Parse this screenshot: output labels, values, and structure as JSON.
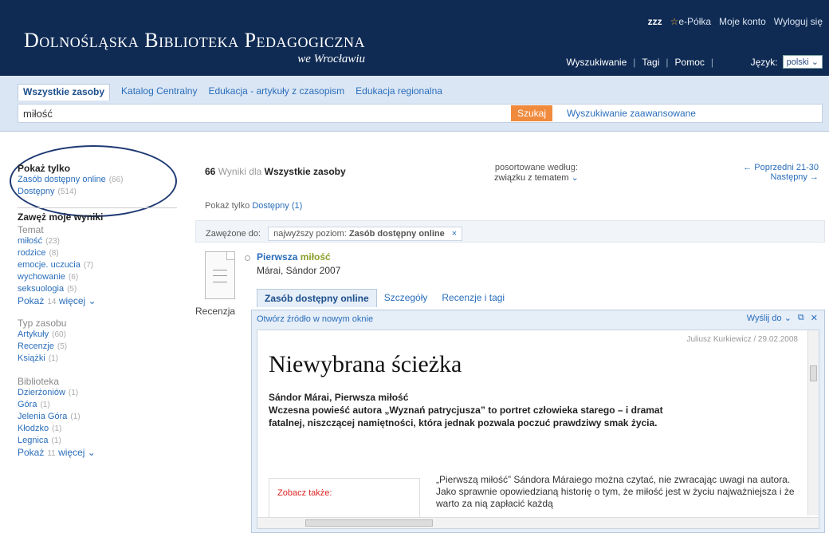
{
  "header": {
    "user": "zzz",
    "user_links": [
      "e-Półka",
      "Moje konto",
      "Wyloguj się"
    ],
    "logo_main": "Dolnośląska Biblioteka Pedagogiczna",
    "logo_sub": "we Wrocławiu",
    "nav": [
      "Wyszukiwanie",
      "Tagi",
      "Pomoc"
    ],
    "lang_label": "Język:",
    "lang_value": "polski"
  },
  "search": {
    "tabs": [
      "Wszystkie zasoby",
      "Katalog Centralny",
      "Edukacja - artykuły z czasopism",
      "Edukacja regionalna"
    ],
    "query": "miłość",
    "button": "Szukaj",
    "advanced": "Wyszukiwanie zaawansowane"
  },
  "sidebar": {
    "pokaz_title": "Pokaż tylko",
    "pokaz_items": [
      {
        "label": "Zasób dostępny online",
        "count": "(66)"
      },
      {
        "label": "Dostępny",
        "count": "(514)"
      }
    ],
    "zawez_title": "Zawęż moje wyniki",
    "temat_title": "Temat",
    "temat_items": [
      {
        "label": "miłość",
        "count": "(23)"
      },
      {
        "label": "rodzice",
        "count": "(8)"
      },
      {
        "label": "emocje. uczucia",
        "count": "(7)"
      },
      {
        "label": "wychowanie",
        "count": "(6)"
      },
      {
        "label": "seksuologia",
        "count": "(5)"
      }
    ],
    "temat_more": {
      "pre": "Pokaż",
      "count": "14",
      "post": "więcej"
    },
    "typ_title": "Typ zasobu",
    "typ_items": [
      {
        "label": "Artykuły",
        "count": "(60)"
      },
      {
        "label": "Recenzje",
        "count": "(5)"
      },
      {
        "label": "Książki",
        "count": "(1)"
      }
    ],
    "bib_title": "Biblioteka",
    "bib_items": [
      {
        "label": "Dzierżoniów",
        "count": "(1)"
      },
      {
        "label": "Góra",
        "count": "(1)"
      },
      {
        "label": "Jelenia Góra",
        "count": "(1)"
      },
      {
        "label": "Kłodzko",
        "count": "(1)"
      },
      {
        "label": "Legnica",
        "count": "(1)"
      }
    ],
    "bib_more": {
      "pre": "Pokaż",
      "count": "11",
      "post": "więcej"
    }
  },
  "results": {
    "count": "66",
    "for_label": "Wyniki dla",
    "scope": "Wszystkie zasoby",
    "sort_label": "posortowane według:",
    "sort_value": "związku z tematem",
    "prev": "Poprzedni",
    "range": "21-30",
    "next": "Następny",
    "pokaz_label": "Pokaż tylko",
    "pokaz_link": "Dostępny",
    "pokaz_count": "(1)",
    "zawezone_label": "Zawężone do:",
    "chip_prefix": "najwyższy poziom:",
    "chip_value": "Zasób dostępny online"
  },
  "record": {
    "doc_label": "Recenzja",
    "title_pre": "Pierwsza",
    "title_hl": "miłość",
    "meta": "Márai, Sándor 2007",
    "tabs": [
      "Zasób dostępny online",
      "Szczegóły",
      "Recenzje i tagi"
    ],
    "open_link": "Otwórz źródło w nowym oknie",
    "send": "Wyślij do",
    "byline": "Juliusz Kurkiewicz / 29.02.2008",
    "article_title": "Niewybrana ścieżka",
    "lead1": "Sándor Márai, Pierwsza miłość",
    "lead2": "Wczesna powieść autora „Wyznań patrycjusza” to portret człowieka starego – i dramat fatalnej, niszczącej namiętności, która jednak pozwala poczuć prawdziwy smak życia.",
    "seealso": "Zobacz także:",
    "body": "„Pierwszą miłość” Sándora Máraiego można czytać, nie zwracając uwagi na autora. Jako sprawnie opowiedzianą historię o tym, że miłość jest w życiu najważniejsza i że warto za nią zapłacić każdą"
  }
}
